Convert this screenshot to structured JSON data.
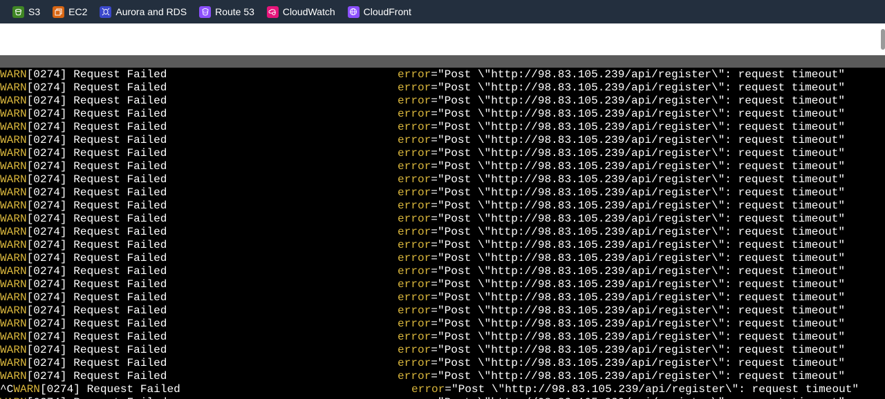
{
  "services": [
    {
      "label": "S3",
      "icon": "s3-icon",
      "color": "#3f8624"
    },
    {
      "label": "EC2",
      "icon": "ec2-icon",
      "color": "#d86613"
    },
    {
      "label": "Aurora and RDS",
      "icon": "rds-icon",
      "color": "#3b48cc"
    },
    {
      "label": "Route 53",
      "icon": "route53-icon",
      "color": "#8c4fff"
    },
    {
      "label": "CloudWatch",
      "icon": "cloudwatch-icon",
      "color": "#e7157b"
    },
    {
      "label": "CloudFront",
      "icon": "cloudfront-icon",
      "color": "#8c4fff"
    }
  ],
  "log": {
    "level": "WARN",
    "counter": "[0274]",
    "message": " Request Failed",
    "error_key": "error",
    "error_value": "=\"Post \\\"http://98.83.105.239/api/register\\\": request timeout\"",
    "interrupt_prefix": "^C",
    "lines": [
      {
        "prefix": ""
      },
      {
        "prefix": ""
      },
      {
        "prefix": ""
      },
      {
        "prefix": ""
      },
      {
        "prefix": ""
      },
      {
        "prefix": ""
      },
      {
        "prefix": ""
      },
      {
        "prefix": ""
      },
      {
        "prefix": ""
      },
      {
        "prefix": ""
      },
      {
        "prefix": ""
      },
      {
        "prefix": ""
      },
      {
        "prefix": ""
      },
      {
        "prefix": ""
      },
      {
        "prefix": ""
      },
      {
        "prefix": ""
      },
      {
        "prefix": ""
      },
      {
        "prefix": ""
      },
      {
        "prefix": ""
      },
      {
        "prefix": ""
      },
      {
        "prefix": ""
      },
      {
        "prefix": ""
      },
      {
        "prefix": ""
      },
      {
        "prefix": ""
      },
      {
        "prefix": "^C"
      },
      {
        "prefix": ""
      }
    ]
  },
  "colors": {
    "warn": "#d9b63c",
    "topbar": "#232f3e"
  }
}
